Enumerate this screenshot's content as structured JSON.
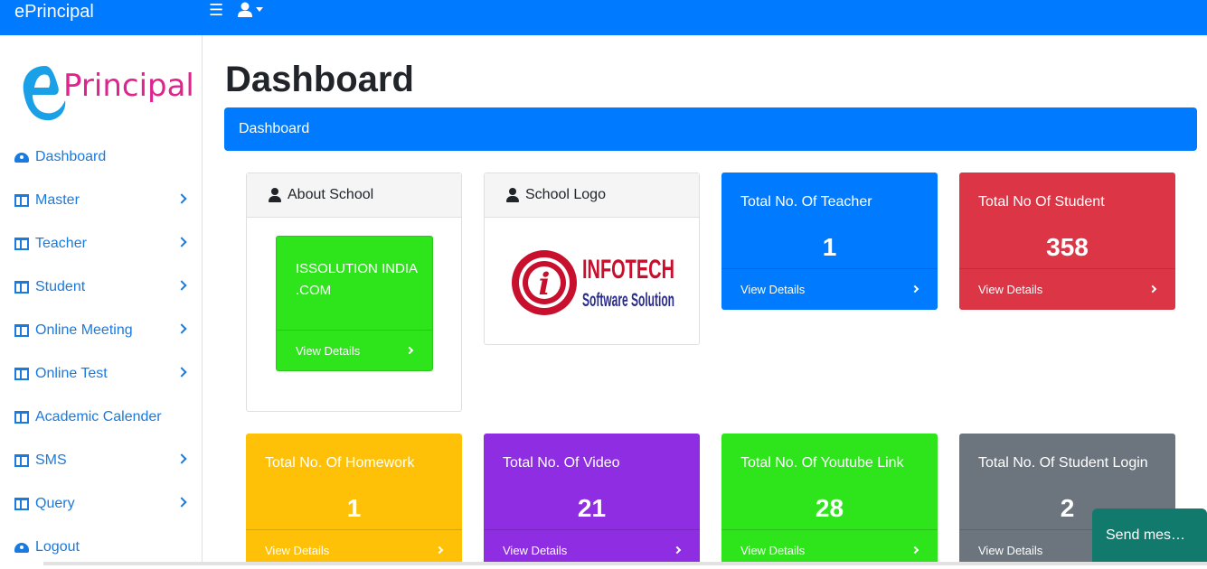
{
  "navbar": {
    "brand": "ePrincipal"
  },
  "sidebar": {
    "logo_text": "Principal",
    "items": [
      {
        "label": "Dashboard",
        "icon": "gauge-icon",
        "chevron": false
      },
      {
        "label": "Master",
        "icon": "columns-icon",
        "chevron": true
      },
      {
        "label": "Teacher",
        "icon": "columns-icon",
        "chevron": true
      },
      {
        "label": "Student",
        "icon": "columns-icon",
        "chevron": true
      },
      {
        "label": "Online Meeting",
        "icon": "columns-icon",
        "chevron": true
      },
      {
        "label": "Online Test",
        "icon": "columns-icon",
        "chevron": true
      },
      {
        "label": "Academic Calender",
        "icon": "columns-icon",
        "chevron": false
      },
      {
        "label": "SMS",
        "icon": "columns-icon",
        "chevron": true
      },
      {
        "label": "Query",
        "icon": "columns-icon",
        "chevron": true
      },
      {
        "label": "Logout",
        "icon": "gauge-icon",
        "chevron": false
      }
    ]
  },
  "main": {
    "title": "Dashboard",
    "breadcrumb": "Dashboard",
    "about_card": {
      "header": "About School",
      "inner_text": "ISSOLUTION INDIA .COM",
      "inner_color": "#2ee51c",
      "inner_link": "View Details"
    },
    "logo_card": {
      "header": "School Logo",
      "logo_title": "INFOTECH",
      "logo_subtitle": "Software Solution"
    },
    "stats": [
      {
        "label": "Total No. Of Teacher",
        "value": "1",
        "link": "View Details",
        "color": "#007bff"
      },
      {
        "label": "Total No Of Student",
        "value": "358",
        "link": "View Details",
        "color": "#dc3545"
      },
      {
        "label": "Total No. Of Homework",
        "value": "1",
        "link": "View Details",
        "color": "#ffc107"
      },
      {
        "label": "Total No. Of Video",
        "value": "21",
        "link": "View Details",
        "color": "#8e2de2"
      },
      {
        "label": "Total No. Of Youtube Link",
        "value": "28",
        "link": "View Details",
        "color": "#2ee51c"
      },
      {
        "label": "Total No. Of Student Login",
        "value": "2",
        "link": "View Details",
        "color": "#6c757d"
      }
    ]
  },
  "chat": {
    "label": "Send mes…"
  }
}
